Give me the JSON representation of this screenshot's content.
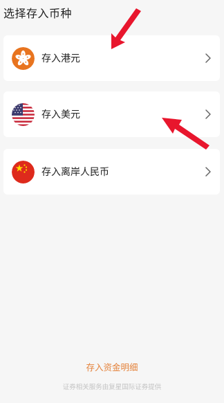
{
  "header": {
    "title": "选择存入币种"
  },
  "currency_options": [
    {
      "label": "存入港元",
      "flag_icon": "hong-kong-flag-icon"
    },
    {
      "label": "存入美元",
      "flag_icon": "us-flag-icon"
    },
    {
      "label": "存入离岸人民币",
      "flag_icon": "china-flag-icon"
    }
  ],
  "footer": {
    "detail_link": "存入资金明细",
    "note": "证券相关服务由复星国际证券提供"
  },
  "colors": {
    "background": "#f6f6f6",
    "card": "#ffffff",
    "accent": "#e4823b",
    "annotation_arrow": "#e8162d"
  }
}
